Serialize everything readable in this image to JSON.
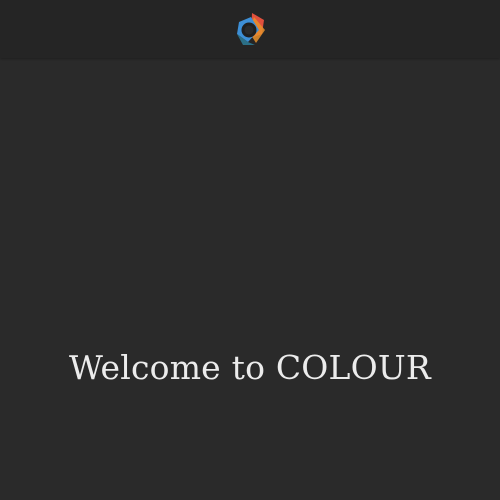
{
  "header": {
    "logo_icon": "colour-logo-icon"
  },
  "hero": {
    "welcome_text": "Welcome to COLOUR"
  },
  "colors": {
    "background": "#2a2a2a",
    "header_background": "#252525",
    "text": "#ececec",
    "logo_red": "#e0503d",
    "logo_orange": "#e8912c",
    "logo_blue": "#3d8fd6",
    "logo_teal": "#2b6f86"
  }
}
